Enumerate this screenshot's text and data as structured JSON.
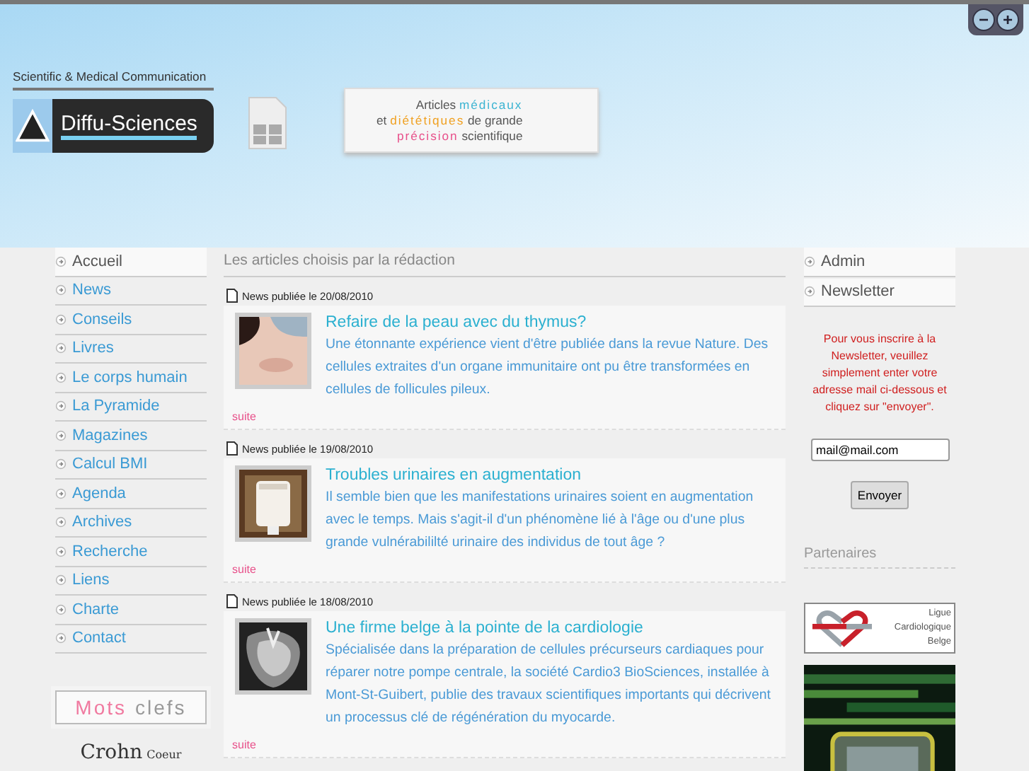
{
  "header": {
    "logo": {
      "subtitle": "Scientific & Medical Communication",
      "name": "Diffu-Sciences"
    },
    "tagline": [
      {
        "text": "Articles ",
        "color": "#555555"
      },
      {
        "text": "médicaux",
        "color": "#3cb4d2"
      },
      {
        "text": "et ",
        "color": "#555555"
      },
      {
        "text": "diététiques",
        "color": "#f0a020"
      },
      {
        "text": " de grande",
        "color": "#555555"
      },
      {
        "text": "précision",
        "color": "#e8508a"
      },
      {
        "text": " scientifique",
        "color": "#555555"
      }
    ],
    "zoom_buttons": [
      "−",
      "+"
    ]
  },
  "nav": [
    {
      "label": "Accueil",
      "selected": true
    },
    {
      "label": "News",
      "selected": false
    },
    {
      "label": "Conseils",
      "selected": false
    },
    {
      "label": "Livres",
      "selected": false
    },
    {
      "label": "Le corps humain",
      "selected": false
    },
    {
      "label": "La Pyramide",
      "selected": false
    },
    {
      "label": "Magazines",
      "selected": false
    },
    {
      "label": "Calcul BMI",
      "selected": false
    },
    {
      "label": "Agenda",
      "selected": false
    },
    {
      "label": "Archives",
      "selected": false
    },
    {
      "label": "Recherche",
      "selected": false
    },
    {
      "label": "Liens",
      "selected": false
    },
    {
      "label": "Charte",
      "selected": false
    },
    {
      "label": "Contact",
      "selected": false
    }
  ],
  "keywords": {
    "title": [
      {
        "text": "Mots",
        "color": "#f07aa0"
      },
      {
        "text": " clefs",
        "color": "#999999"
      }
    ],
    "tags": [
      "Crohn",
      "Coeur"
    ]
  },
  "main": {
    "heading": "Les articles choisis par la rédaction",
    "articles": [
      {
        "date": "News publiée le 20/08/2010",
        "title": "Refaire de la peau avec du thymus?",
        "text": "Une étonnante expérience vient d'être publiée dans la revue Nature. Des cellules extraites d'un organe immunitaire ont pu être transformées en cellules de follicules pileux.",
        "more": "suite"
      },
      {
        "date": "News publiée le 19/08/2010",
        "title": "Troubles urinaires en augmentation",
        "text": "Il semble bien que les manifestations urinaires soient en augmentation avec le temps. Mais s'agit-il d'un phénomène lié à l'âge ou d'une plus grande vulnérabililté urinaire des individus de tout âge ?",
        "more": "suite"
      },
      {
        "date": "News publiée le 18/08/2010",
        "title": "Une firme belge à la pointe de la cardiologie",
        "text": "Spécialisée dans la préparation de cellules précurseurs cardiaques pour réparer notre pompe centrale, la société Cardio3 BioSciences, installée à Mont-St-Guibert, publie des travaux scientifiques importants qui décrivent un processus clé de régénération du myocarde.",
        "more": "suite"
      }
    ]
  },
  "right": {
    "menu": [
      "Admin",
      "Newsletter"
    ],
    "newsletter": {
      "text": "Pour vous inscrire à la Newsletter, veuillez simplement enter votre adresse mail ci-dessous et cliquez sur \"envoyer\".",
      "email": "mail@mail.com",
      "button": "Envoyer"
    },
    "partners": {
      "heading": "Partenaires",
      "logo_text": [
        "Ligue",
        "Cardiologique",
        "Belge"
      ]
    }
  }
}
